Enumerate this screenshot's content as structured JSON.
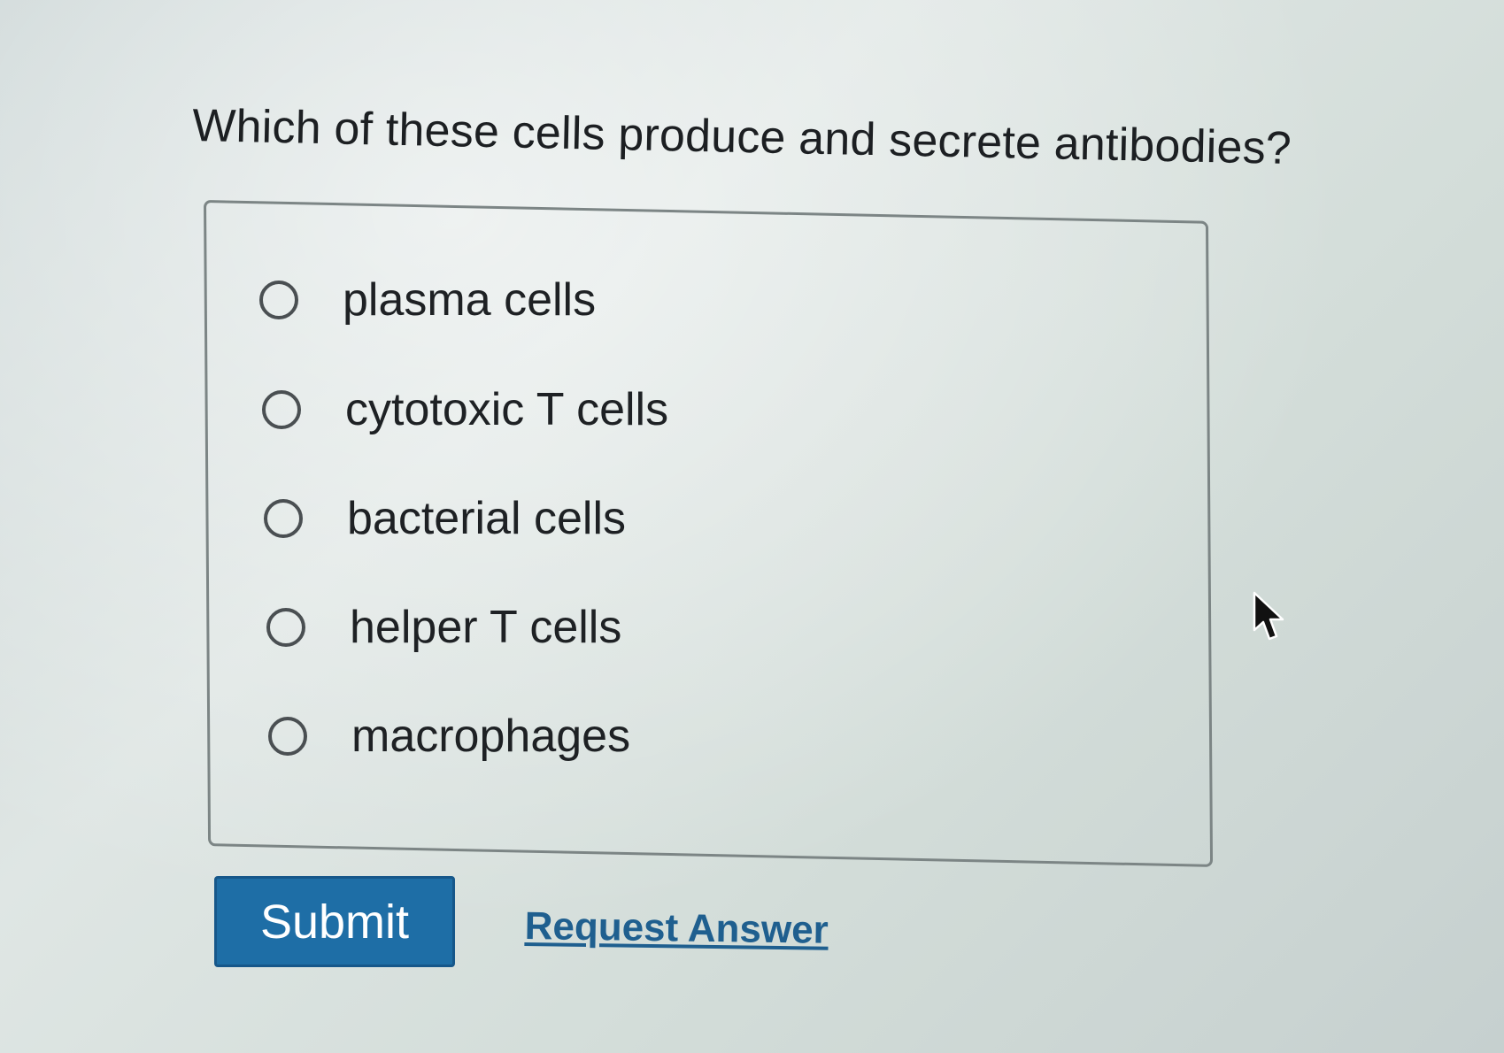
{
  "question": {
    "text": "Which of these cells produce and secrete antibodies?"
  },
  "options": [
    {
      "label": "plasma cells",
      "selected": false
    },
    {
      "label": "cytotoxic T cells",
      "selected": false
    },
    {
      "label": "bacterial cells",
      "selected": false
    },
    {
      "label": "helper T cells",
      "selected": false
    },
    {
      "label": "macrophages",
      "selected": false
    }
  ],
  "actions": {
    "submit_label": "Submit",
    "request_answer_label": "Request Answer"
  },
  "icons": {
    "radio": "radio-unselected-icon",
    "cursor": "mouse-pointer-icon"
  },
  "colors": {
    "submit_bg": "#1e6ea6",
    "link": "#1f5f8f",
    "text": "#1e2124"
  }
}
